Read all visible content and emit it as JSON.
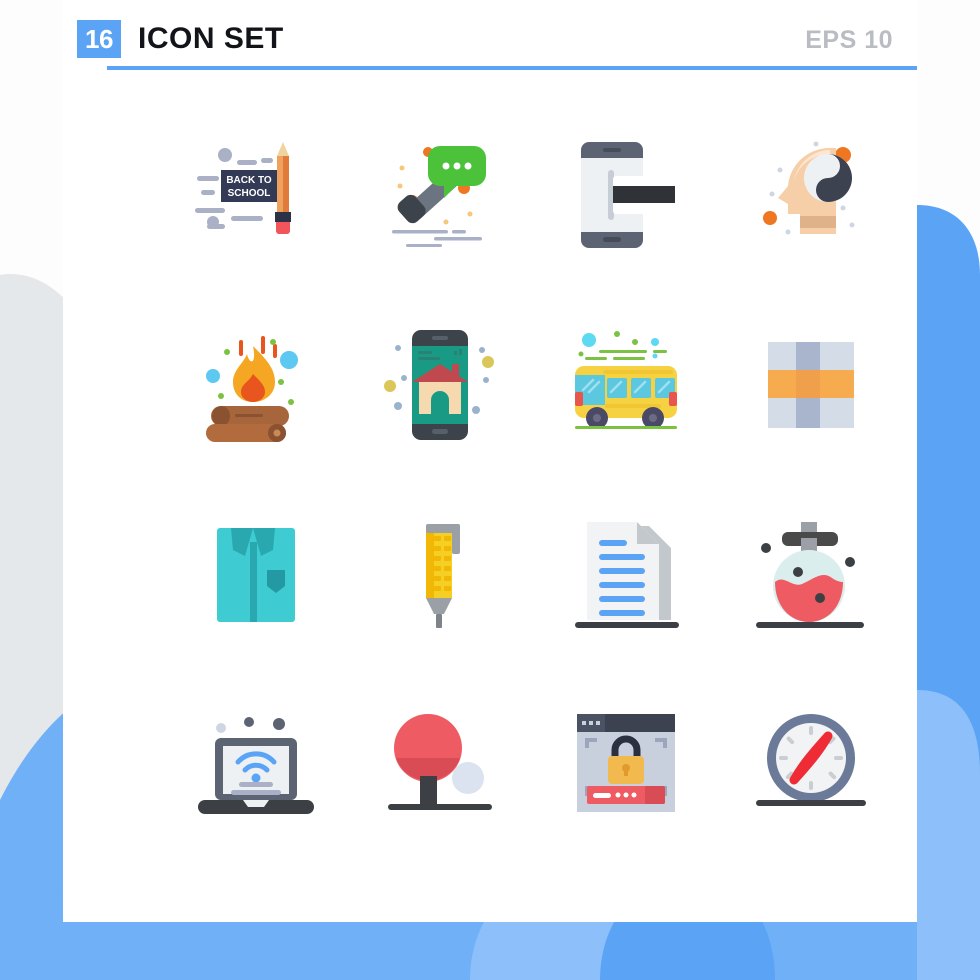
{
  "header": {
    "count_badge": "16",
    "title": "ICON SET",
    "format_label": "EPS 10",
    "accent_color": "#5ba4f5",
    "title_color": "#12141a",
    "format_color": "#b9bcc2"
  },
  "background": {
    "page_color": "#fdfdfe",
    "sheet_color": "#ffffff",
    "wave_blue": "#5ba4f5",
    "wave_blue_light": "#8dc0fa",
    "wave_grey": "#e5e8ea"
  },
  "grid": {
    "columns": 4,
    "rows": 4,
    "total_icons": 16
  },
  "icons": [
    {
      "index": 1,
      "name": "back-to-school-pencil",
      "label": "Back To School",
      "board_text_line1": "BACK TO",
      "board_text_line2": "SCHOOL",
      "colors": [
        "#333a56",
        "#e07b39",
        "#f0d3a0",
        "#f2545b",
        "#2b3147",
        "#aab0c6"
      ]
    },
    {
      "index": 2,
      "name": "phone-call-chat",
      "label": "Phone Call Message",
      "colors": [
        "#3c434b",
        "#6b7480",
        "#4cc23b",
        "#ffffff",
        "#ef7721",
        "#aab0c6"
      ]
    },
    {
      "index": 3,
      "name": "mobile-payment-card",
      "label": "Mobile Card Payment",
      "colors": [
        "#5c6372",
        "#eef1f3",
        "#ffffff",
        "#2f3337",
        "#c7cdd4"
      ]
    },
    {
      "index": 4,
      "name": "head-yin-yang-balance",
      "label": "Mindfulness Balance",
      "colors": [
        "#f6cfa8",
        "#fadfc3",
        "#e0b289",
        "#3c4250",
        "#eef1f3",
        "#ef7721"
      ]
    },
    {
      "index": 5,
      "name": "campfire-logs",
      "label": "Campfire",
      "colors": [
        "#f5a623",
        "#f47b20",
        "#e8551f",
        "#9b5a32",
        "#b26b3c",
        "#5dc8f2",
        "#7cc242"
      ]
    },
    {
      "index": 6,
      "name": "mobile-home-app",
      "label": "Smart Home App",
      "colors": [
        "#3c434b",
        "#199a85",
        "#f6d9ae",
        "#c0484f",
        "#e9c89a",
        "#dbc65a",
        "#9ab3cc"
      ]
    },
    {
      "index": 7,
      "name": "school-bus",
      "label": "School Bus",
      "colors": [
        "#f6d243",
        "#5bc8e0",
        "#4a4a66",
        "#e8554d",
        "#7cc242",
        "#5dd9f2"
      ]
    },
    {
      "index": 8,
      "name": "gift-package",
      "label": "Gift Package",
      "colors": [
        "#d4dce8",
        "#a8b5cd",
        "#f7ab4f",
        "#f0a04a"
      ]
    },
    {
      "index": 9,
      "name": "folded-shirt",
      "label": "Shirt",
      "colors": [
        "#3ecbd1",
        "#2aa8b0",
        "#239aa3"
      ]
    },
    {
      "index": 10,
      "name": "pen",
      "label": "Pen",
      "colors": [
        "#f5cf23",
        "#f2b705",
        "#9aa0a6",
        "#7d8388"
      ]
    },
    {
      "index": 11,
      "name": "document-file",
      "label": "Document",
      "colors": [
        "#f1f3f4",
        "#c3c8cc",
        "#5ba4f5",
        "#3c4044"
      ]
    },
    {
      "index": 12,
      "name": "lab-flask",
      "label": "Lab Flask",
      "colors": [
        "#dbeeee",
        "#ef5b63",
        "#4a4a4a",
        "#9aa0a6",
        "#3c4044"
      ]
    },
    {
      "index": 13,
      "name": "laptop-wifi",
      "label": "Laptop Wi-Fi",
      "colors": [
        "#5c6372",
        "#3c4044",
        "#eef1f3",
        "#5ba4f5",
        "#aab0c6"
      ]
    },
    {
      "index": 14,
      "name": "table-tennis-paddle",
      "label": "Table Tennis",
      "colors": [
        "#ef5b63",
        "#d94c55",
        "#3c4044",
        "#dbe2f0"
      ]
    },
    {
      "index": 15,
      "name": "browser-password-lock",
      "label": "Password Security",
      "colors": [
        "#c8cfdd",
        "#3c4250",
        "#f2b94f",
        "#e09a2e",
        "#ef5b63",
        "#d94c55",
        "#ffffff"
      ]
    },
    {
      "index": 16,
      "name": "compass",
      "label": "Compass",
      "colors": [
        "#6b7a99",
        "#f1f3f4",
        "#ef2b36",
        "#c9ced3",
        "#3c4044"
      ]
    }
  ]
}
